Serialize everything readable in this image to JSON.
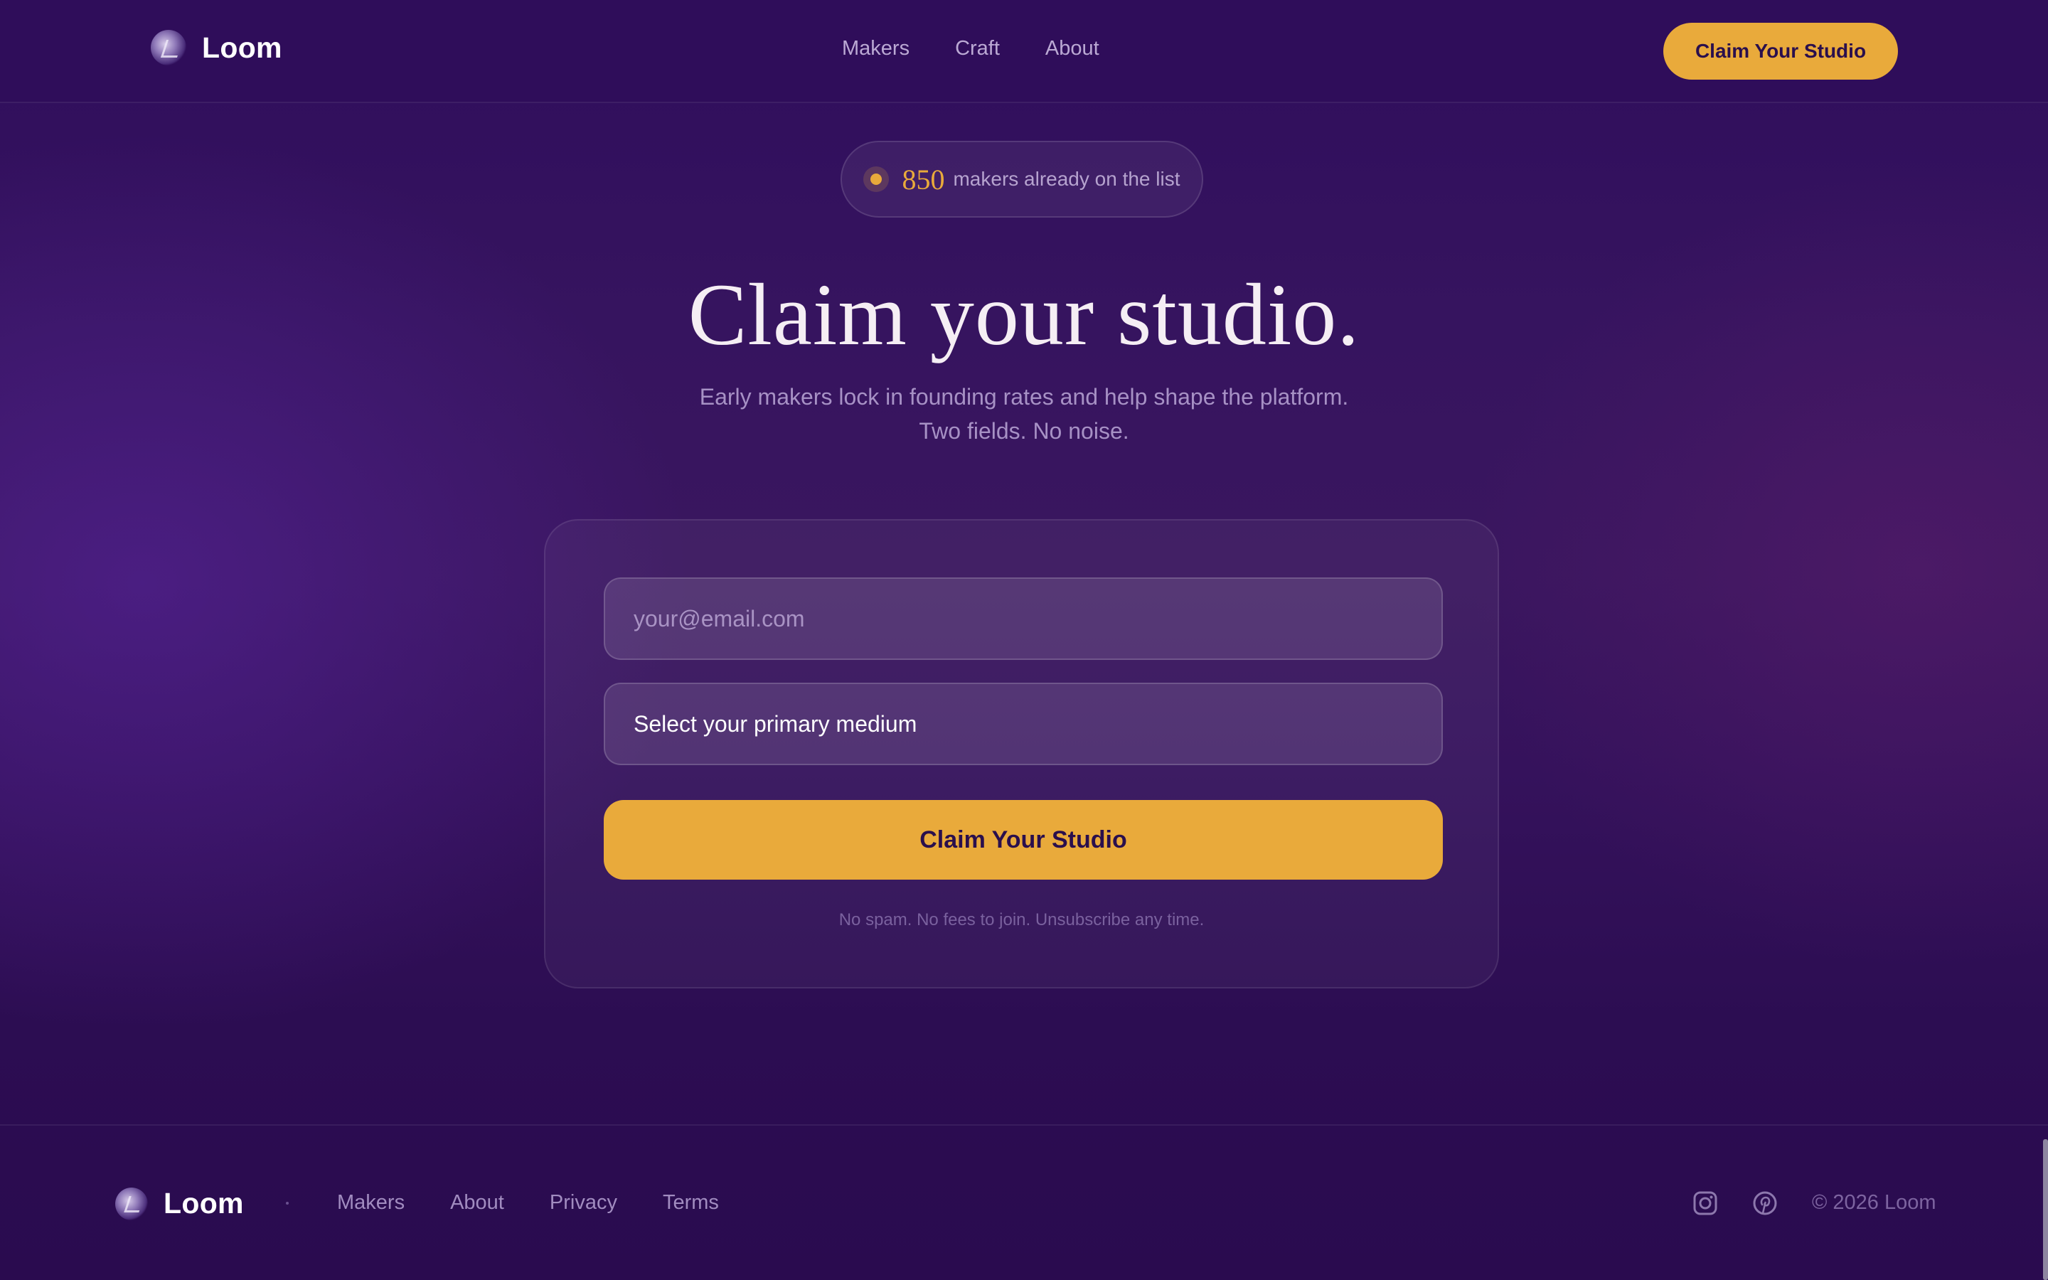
{
  "header": {
    "brand": "Loom",
    "nav": [
      "Makers",
      "Craft",
      "About"
    ],
    "cta_label": "Claim Your Studio"
  },
  "hero": {
    "badge_count": "850",
    "badge_text": "makers already on the list",
    "title": "Claim your studio.",
    "subtitle_line1": "Early makers lock in founding rates and help shape the platform.",
    "subtitle_line2": "Two fields. No noise."
  },
  "form": {
    "email_placeholder": "your@email.com",
    "email_value": "",
    "medium_label": "Select your primary medium",
    "submit_label": "Claim Your Studio",
    "fineprint": "No spam. No fees to join. Unsubscribe any time."
  },
  "footer": {
    "brand": "Loom",
    "links": [
      "Makers",
      "About",
      "Privacy",
      "Terms"
    ],
    "social_icons": [
      "instagram-icon",
      "pinterest-icon"
    ],
    "copyright": "© 2026 Loom"
  },
  "colors": {
    "accent": "#e9aa3b",
    "background": "#2f0d5a",
    "title": "#f5eef4",
    "muted": "#a791c5"
  }
}
